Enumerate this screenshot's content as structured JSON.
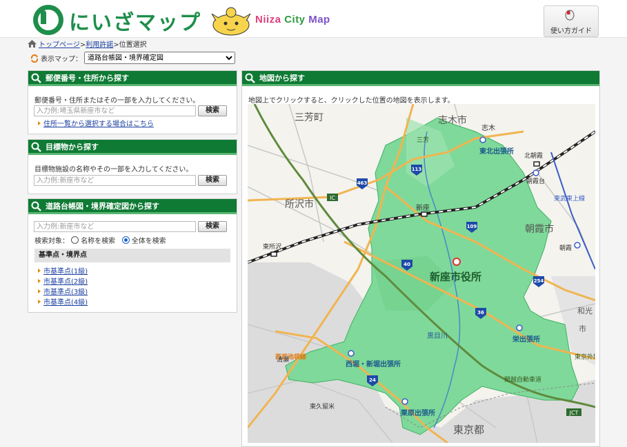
{
  "header": {
    "logo_text": "にいざマップ",
    "subtitle": {
      "n": "Niiza",
      "c": "City",
      "m": "Map"
    },
    "guide_button": "使い方ガイド"
  },
  "breadcrumb": {
    "home": "トップページ",
    "sep": ">",
    "terms": "利用許諾",
    "current": "位置選択"
  },
  "map_selector": {
    "label": "表示マップ：",
    "selected": "道路台帳図・境界確定図"
  },
  "postal": {
    "title": "郵便番号・住所から探す",
    "desc": "郵便番号・住所またはその一部を入力してください。",
    "placeholder": "入力例:埼玉県新座市など",
    "search": "検索",
    "link": "住所一覧から選択する場合はこちら"
  },
  "landmark": {
    "title": "目標物から探す",
    "desc": "目標物施設の名称やその一部を入力してください。",
    "placeholder": "入力例:新座市など",
    "search": "検索"
  },
  "road": {
    "title": "道路台帳図・境界確定図から探す",
    "placeholder": "入力例:新座市など",
    "search": "検索",
    "target_label": "検索対象：",
    "opt_name": "名称を検索",
    "opt_all": "全体を検索",
    "section": "基準点・境界点",
    "items": [
      "市基準点(1級)",
      "市基準点(2級)",
      "市基準点(3級)",
      "市基準点(4級)"
    ]
  },
  "mapsearch": {
    "title": "地図から探す",
    "desc": "地図上でクリックすると、クリックした位置の地図を表示します。"
  },
  "map": {
    "labels": {
      "miyoshi": "三芳町",
      "shiki": "志木市",
      "shiki_st": "志木",
      "tohoku": "東北出張所",
      "kitaasaka": "北朝霞",
      "asakadai": "朝霞台",
      "tokorozawa": "所沢市",
      "niiza_st": "新座",
      "asaka": "朝霞市",
      "asaka_st": "朝霞",
      "higashitokorozawa": "東所沢",
      "cityhall": "新座市役所",
      "wako": "和光",
      "wako2": "市",
      "sakaede": "栄出張所",
      "seibu": "西武池袋線",
      "kiyose": "清瀬",
      "nishibori": "西堀・新堀出張所",
      "kurome": "黒目川",
      "kanetsu": "関越自動車道",
      "higashikurume": "東久留米",
      "kurihara": "栗原出張所",
      "tokyo": "東京都",
      "tobu": "東武東上線",
      "sanbou": "三芳",
      "gaikan": "東京外環",
      "ic": "IC",
      "jct": "JCT"
    },
    "routes": [
      "463",
      "113",
      "109",
      "40",
      "254",
      "36",
      "24"
    ],
    "colors": {
      "city": "#7fd99a",
      "city_dark": "#3fb060",
      "water": "#4a86c8",
      "road": "#f1b451",
      "expressway": "#5f8a3c"
    }
  }
}
